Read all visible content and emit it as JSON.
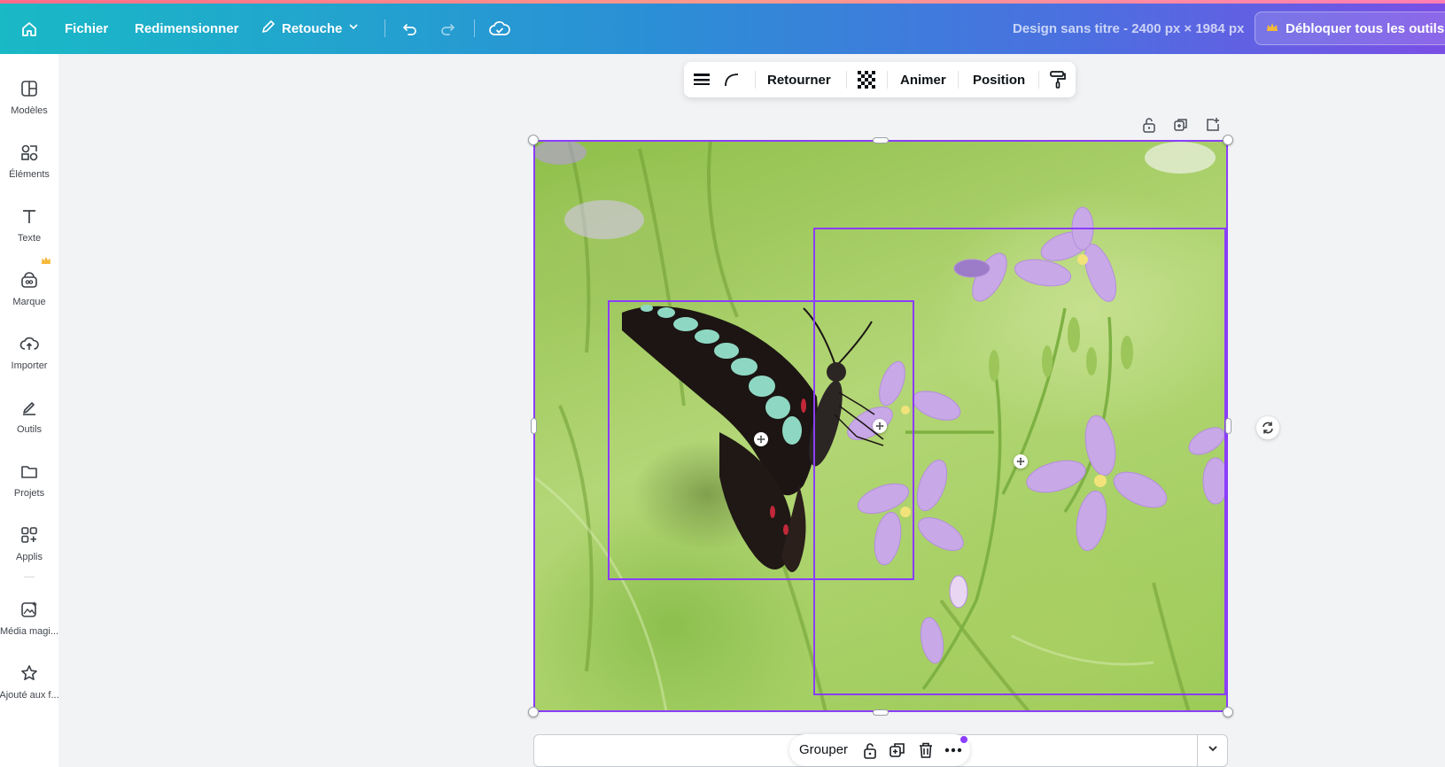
{
  "header": {
    "file_label": "Fichier",
    "resize_label": "Redimensionner",
    "edit_label": "Retouche",
    "design_title": "Design sans titre - 2400 px × 1984 px",
    "unlock_label": "Débloquer tous les outils",
    "accent_colors": [
      "#19b9c6",
      "#4c6fe0",
      "#7a4fe6"
    ]
  },
  "sidebar": {
    "items": [
      {
        "label": "Modèles",
        "icon": "templates-icon"
      },
      {
        "label": "Éléments",
        "icon": "elements-icon"
      },
      {
        "label": "Texte",
        "icon": "text-icon"
      },
      {
        "label": "Marque",
        "icon": "brand-icon"
      },
      {
        "label": "Importer",
        "icon": "upload-icon"
      },
      {
        "label": "Outils",
        "icon": "tools-icon"
      },
      {
        "label": "Projets",
        "icon": "folder-icon"
      },
      {
        "label": "Applis",
        "icon": "apps-icon"
      },
      {
        "label": "Média magi...",
        "icon": "magic-media-icon"
      },
      {
        "label": "Ajouté aux f...",
        "icon": "star-icon"
      }
    ]
  },
  "context_toolbar": {
    "flip_label": "Retourner",
    "animate_label": "Animer",
    "position_label": "Position"
  },
  "selection": {
    "color": "#8b3dff"
  },
  "bottom": {
    "group_label": "Grouper"
  }
}
